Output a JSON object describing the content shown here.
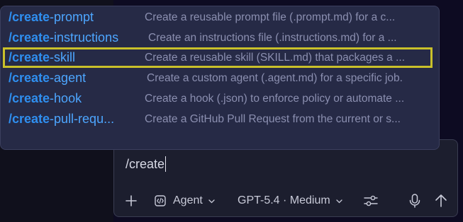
{
  "input": {
    "value": "/create"
  },
  "toolbar": {
    "mode_label": "Agent",
    "model_label": "GPT-5.4 · Medium",
    "icons": [
      "plus-icon",
      "agent-mode-icon",
      "chevron-down-icon",
      "settings-sliders-icon",
      "microphone-icon",
      "send-arrow-icon"
    ]
  },
  "suggestions": {
    "prefix": "/create",
    "items": [
      {
        "suffix": "-prompt",
        "description": "Create a reusable prompt file (.prompt.md) for a c..."
      },
      {
        "suffix": "-instructions",
        "description": "Create an instructions file (.instructions.md) for a ..."
      },
      {
        "suffix": "-skill",
        "description": "Create a reusable skill (SKILL.md) that packages a ..."
      },
      {
        "suffix": "-agent",
        "description": "Create a custom agent (.agent.md) for a specific job."
      },
      {
        "suffix": "-hook",
        "description": "Create a hook (.json) to enforce policy or automate ..."
      },
      {
        "suffix": "-pull-requ...",
        "description": "Create a GitHub Pull Request from the current or s..."
      }
    ],
    "selected_index": 2
  },
  "colors": {
    "accent": "#2f8ff0",
    "selection_border": "#c9c02a",
    "popup_bg": "#262a46"
  }
}
